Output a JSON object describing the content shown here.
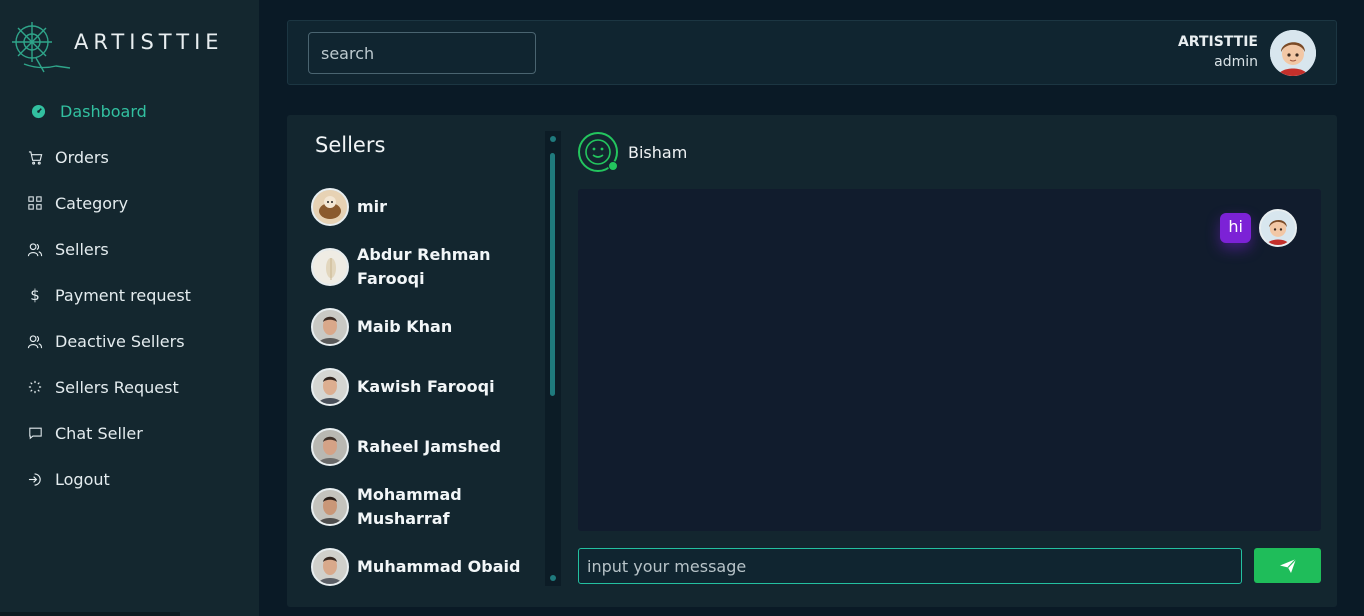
{
  "app": {
    "logo_text": "ARTISTTIE"
  },
  "sidebar": {
    "items": [
      {
        "label": "Dashboard",
        "icon": "dashboard-gauge-icon",
        "active": true
      },
      {
        "label": "Orders",
        "icon": "cart-icon"
      },
      {
        "label": "Category",
        "icon": "grid-icon"
      },
      {
        "label": "Sellers",
        "icon": "users-icon"
      },
      {
        "label": "Payment request",
        "icon": "dollar-icon"
      },
      {
        "label": "Deactive Sellers",
        "icon": "users-icon"
      },
      {
        "label": "Sellers Request",
        "icon": "loader-icon"
      },
      {
        "label": "Chat Seller",
        "icon": "chat-icon"
      },
      {
        "label": "Logout",
        "icon": "logout-icon"
      }
    ]
  },
  "header": {
    "search_placeholder": "search",
    "user": {
      "name": "ARTISTTIE",
      "role": "admin"
    }
  },
  "sellers_panel": {
    "title": "Sellers",
    "sellers": [
      {
        "name": "mir"
      },
      {
        "name": "Abdur Rehman Farooqi"
      },
      {
        "name": "Maib Khan"
      },
      {
        "name": "Kawish Farooqi"
      },
      {
        "name": "Raheel Jamshed"
      },
      {
        "name": "Mohammad Musharraf"
      },
      {
        "name": "Muhammad Obaid"
      }
    ]
  },
  "chat": {
    "contact_name": "Bisham",
    "contact_online": true,
    "messages": [
      {
        "text": "hi",
        "from": "admin"
      }
    ],
    "input_placeholder": "input your message"
  },
  "colors": {
    "accent": "#32c0a0",
    "send_button": "#1fbd5a",
    "bubble": "#7c22d6",
    "online": "#23c55e"
  }
}
